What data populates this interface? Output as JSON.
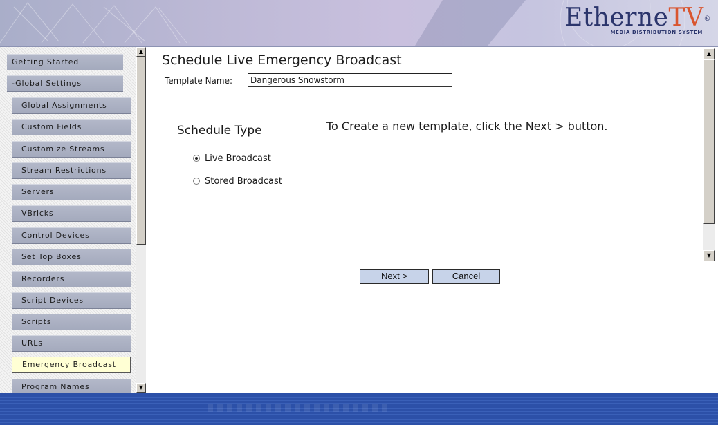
{
  "header": {
    "logo_ether": "Etherne",
    "logo_tv": "TV",
    "logo_reg": "®",
    "logo_tagline": "MEDIA DISTRIBUTION SYSTEM"
  },
  "sidebar": {
    "items": [
      {
        "label": "Getting Started"
      },
      {
        "label": "-Global Settings"
      },
      {
        "label": "Global Assignments"
      },
      {
        "label": "Custom Fields"
      },
      {
        "label": "Customize Streams"
      },
      {
        "label": "Stream Restrictions"
      },
      {
        "label": "Servers"
      },
      {
        "label": "VBricks"
      },
      {
        "label": "Control Devices"
      },
      {
        "label": "Set Top Boxes"
      },
      {
        "label": "Recorders"
      },
      {
        "label": "Script Devices"
      },
      {
        "label": "Scripts"
      },
      {
        "label": "URLs"
      },
      {
        "label": "Emergency Broadcast"
      },
      {
        "label": "Program Names"
      }
    ],
    "active_item": "Emergency Broadcast"
  },
  "main": {
    "title": "Schedule Live Emergency Broadcast",
    "template_label": "Template Name:",
    "template_value": "Dangerous Snowstorm",
    "schedule_type_heading": "Schedule Type",
    "hint": "To Create a new template, click the Next > button.",
    "options": [
      {
        "label": "Live Broadcast",
        "selected": true
      },
      {
        "label": "Stored Broadcast",
        "selected": false
      }
    ]
  },
  "buttons": {
    "next": "Next >",
    "cancel": "Cancel"
  },
  "icons": {
    "scroll_up": "▲",
    "scroll_down": "▼"
  },
  "colors": {
    "banner_navy": "#2b356c",
    "logo_accent": "#d9552f",
    "nav_button": "#a9afc1",
    "nav_active": "#ffffd4",
    "button_face": "#c7d3e9",
    "footer_blue": "#2c50a8"
  }
}
